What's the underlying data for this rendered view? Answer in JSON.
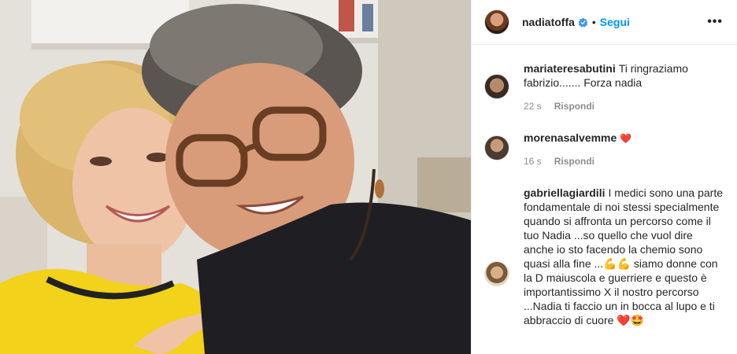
{
  "post": {
    "username": "nadiatoffa",
    "follow_label": "Segui",
    "separator": "•",
    "more_label": "•••"
  },
  "comments": [
    {
      "username": "mariateresabutini",
      "text": "Ti ringraziamo fabrizio....... Forza nadia",
      "time": "22 s",
      "reply_label": "Rispondi"
    },
    {
      "username": "morenasalvemme",
      "text": "❤️",
      "time": "16 s",
      "reply_label": "Rispondi"
    },
    {
      "username": "gabriellagiardili",
      "text": "I medici sono una parte fondamentale di noi stessi specialmente quando si affronta un percorso come il tuo Nadia ...so quello che vuol dire anche io sto facendo la chemio sono quasi alla fine ...💪💪 siamo donne con la D maiuscola e guerriere e questo è importantissimo X il nostro percorso ...Nadia ti faccio un in bocca al lupo e ti abbraccio di cuore ❤️🤩"
    }
  ],
  "icons": {
    "verified": "verified-badge-icon",
    "more": "more-options-icon"
  },
  "colors": {
    "link_blue": "#0095f6",
    "text": "#262626",
    "muted": "#8e8e8e",
    "border": "#efefef"
  }
}
